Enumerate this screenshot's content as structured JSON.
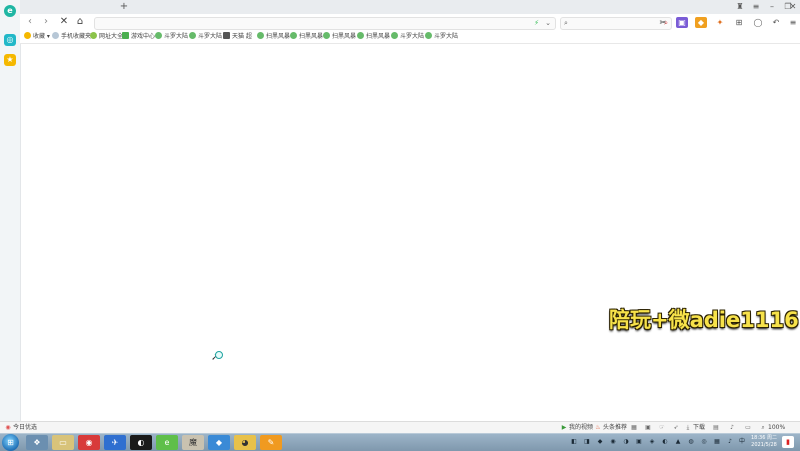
{
  "colors": {
    "accent": "#1fb6a3",
    "watermark": "#f7e24a",
    "taskbar": "#8aa3b8"
  },
  "bookmarks": [
    {
      "label": "收藏",
      "icon": "star-icon"
    },
    {
      "label": "手机收藏夹",
      "icon": "phone-icon"
    },
    {
      "label": "网址大全",
      "icon": "hao-icon"
    },
    {
      "label": "游戏中心",
      "icon": "game-icon"
    },
    {
      "label": "斗罗大陆",
      "icon": "globe-icon"
    },
    {
      "label": "斗罗大陆",
      "icon": "globe-icon"
    },
    {
      "label": "天猫 超",
      "icon": "tmall-icon"
    },
    {
      "label": "扫黑风暴",
      "icon": "globe-icon"
    },
    {
      "label": "扫黑风暴",
      "icon": "globe-icon"
    },
    {
      "label": "扫黑风暴",
      "icon": "globe-icon"
    },
    {
      "label": "扫黑风暴",
      "icon": "globe-icon"
    },
    {
      "label": "斗罗大陆",
      "icon": "globe-icon"
    },
    {
      "label": "斗罗大陆",
      "icon": "globe-icon"
    }
  ],
  "watermark": "陪玩+微adie1116",
  "status": {
    "left": "今日优选",
    "video": "我的视频",
    "headline": "头条推荐",
    "download": "下载",
    "zoom": "100%"
  },
  "clock": {
    "time": "18:36 周二",
    "date": "2021/5/28"
  }
}
